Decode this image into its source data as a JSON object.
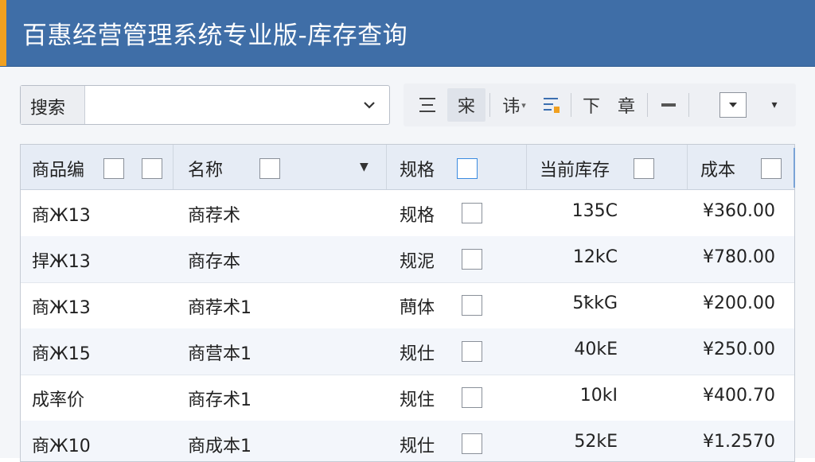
{
  "window": {
    "title": "百惠经营管理系统专业版-库存查询"
  },
  "search": {
    "label": "搜索",
    "value": "",
    "dropdown_icon": "chevron-down-icon"
  },
  "toolbar": {
    "buttons": [
      {
        "glyph": "☰",
        "icon": "align-icon"
      },
      {
        "glyph": "宩",
        "icon": "layout-icon"
      },
      {
        "glyph": "讳",
        "icon": "format-icon"
      },
      {
        "glyph": "⇅",
        "icon": "sort-icon"
      },
      {
        "glyph": "下",
        "icon": "down-icon"
      },
      {
        "glyph": "章",
        "icon": "chapter-icon"
      },
      {
        "glyph": "−",
        "icon": "minus-icon"
      }
    ],
    "menu_arrow": "▾"
  },
  "table": {
    "columns": [
      "商品编",
      "名称",
      "规格",
      "当前库存",
      "成本"
    ],
    "rows": [
      {
        "code": "商Ж13",
        "name": "商荐术",
        "spec": "规格",
        "stock": "135C",
        "cost": "¥360.00"
      },
      {
        "code": "捍Ж13",
        "name": "商存本",
        "spec": "规泥",
        "stock": "12kC",
        "cost": "¥780.00"
      },
      {
        "code": "商Ж13",
        "name": "商荐术1",
        "spec": "蔄体",
        "stock": "5ꝁkG",
        "cost": "¥200.00"
      },
      {
        "code": "商Ж15",
        "name": "商营本1",
        "spec": "规仕",
        "stock": "40kE",
        "cost": "¥250.00"
      },
      {
        "code": "成率价",
        "name": "商存术1",
        "spec": "规住",
        "stock": "10kI",
        "cost": "¥400.70"
      },
      {
        "code": "商Ж10",
        "name": "商成本1",
        "spec": "规仕",
        "stock": "52kE",
        "cost": "¥1.2570"
      }
    ]
  },
  "colors": {
    "title_bar": "#3f6ea7",
    "accent": "#f0a020",
    "header_bg": "#e6ecf5"
  }
}
